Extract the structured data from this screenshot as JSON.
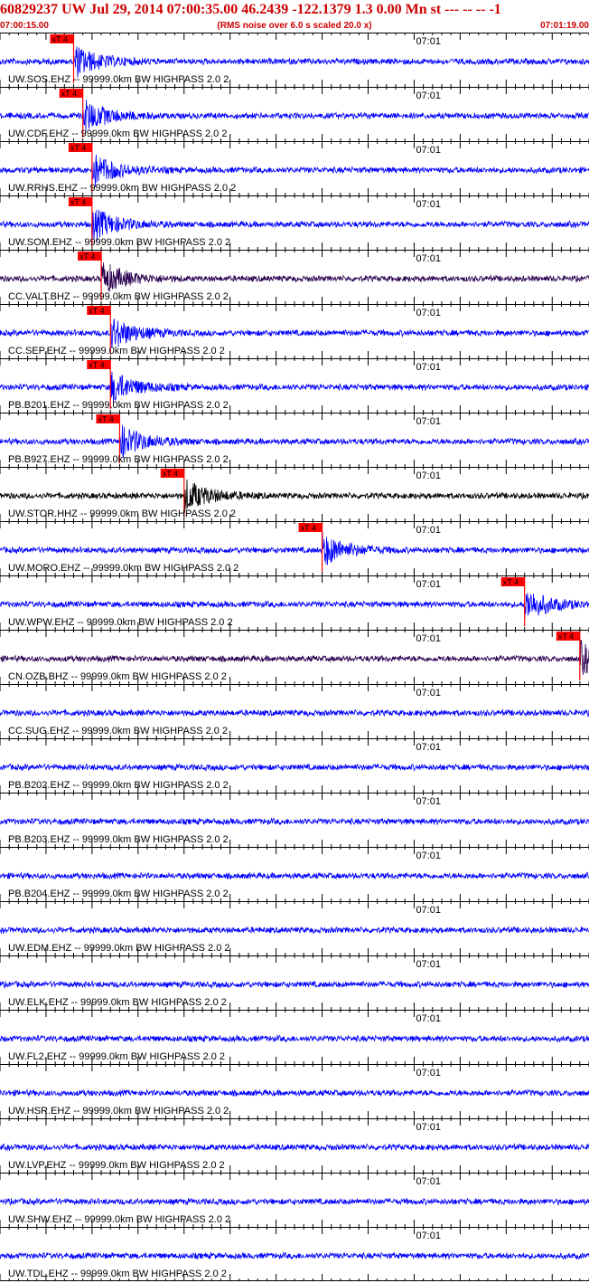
{
  "header": {
    "title": "60829237 UW Jul 29, 2014 07:00:35.00   46.2439 -122.1379  1.3 0.00 Mn st --- -- --  -1",
    "start_time": "07:00:15.00",
    "noise_note": "(RMS noise over 6.0 s scaled 20.0 x)",
    "end_time": "07:01:19.00"
  },
  "colors": {
    "accent": "#cc0000",
    "trace_blue": "#0000ff",
    "trace_purple": "#2a0050",
    "trace_black": "#000000",
    "pick_box": "#ff0000"
  },
  "chart_data": {
    "type": "line",
    "x_start": "07:00:15.00",
    "x_end": "07:01:19.00",
    "minute_tick_label": "07:01",
    "pick_label": "xT 4",
    "traces": [
      {
        "name": "UW.SOS.EHZ -- 99999.0km BW  HIGHPASS  2.0  2",
        "color": "trace_blue",
        "pick_time": "07:00:23"
      },
      {
        "name": "UW.CDF.EHZ -- 99999.0km BW  HIGHPASS  2.0  2",
        "color": "trace_blue",
        "pick_time": "07:00:24"
      },
      {
        "name": "UW.RRHS.EHZ -- 99999.0km BW  HIGHPASS  2.0  2",
        "color": "trace_blue",
        "pick_time": "07:00:25"
      },
      {
        "name": "UW.SOM.EHZ -- 99999.0km BW  HIGHPASS  2.0  2",
        "color": "trace_blue",
        "pick_time": "07:00:25"
      },
      {
        "name": "CC.VALT.BHZ -- 99999.0km BW  HIGHPASS  2.0  2",
        "color": "trace_purple",
        "pick_time": "07:00:26"
      },
      {
        "name": "CC.SEP.EHZ -- 99999.0km BW  HIGHPASS  2.0  2",
        "color": "trace_blue",
        "pick_time": "07:00:27"
      },
      {
        "name": "PB.B201.EHZ -- 99999.0km BW  HIGHPASS  2.0  2",
        "color": "trace_blue",
        "pick_time": "07:00:27"
      },
      {
        "name": "PB.B927.EHZ -- 99999.0km BW  HIGHPASS  2.0  2",
        "color": "trace_blue",
        "pick_time": "07:00:28"
      },
      {
        "name": "UW.STOR.HHZ -- 99999.0km BW  HIGHPASS  2.0  2",
        "color": "trace_black",
        "pick_time": "07:00:35"
      },
      {
        "name": "UW.MORO.EHZ -- 99999.0km BW  HIGHPASS  2.0  2",
        "color": "trace_blue",
        "pick_time": "07:00:50"
      },
      {
        "name": "UW.WPW.EHZ -- 99999.0km BW  HIGHPASS  2.0  2",
        "color": "trace_blue",
        "pick_time": "07:01:12"
      },
      {
        "name": "CN.OZB.BHZ -- 99999.0km BW  HIGHPASS  2.0  2",
        "color": "trace_purple",
        "pick_time": "07:01:18"
      },
      {
        "name": "CC.SUG.EHZ -- 99999.0km BW  HIGHPASS  2.0  2",
        "color": "trace_blue"
      },
      {
        "name": "PB.B202.EHZ -- 99999.0km BW  HIGHPASS  2.0  2",
        "color": "trace_blue"
      },
      {
        "name": "PB.B203.EHZ -- 99999.0km BW  HIGHPASS  2.0  2",
        "color": "trace_blue"
      },
      {
        "name": "PB.B204.EHZ -- 99999.0km BW  HIGHPASS  2.0  2",
        "color": "trace_blue"
      },
      {
        "name": "UW.EDM.EHZ -- 99999.0km BW  HIGHPASS  2.0  2",
        "color": "trace_blue"
      },
      {
        "name": "UW.ELK.EHZ -- 99999.0km BW  HIGHPASS  2.0  2",
        "color": "trace_blue"
      },
      {
        "name": "UW.FL2.EHZ -- 99999.0km BW  HIGHPASS  2.0  2",
        "color": "trace_blue"
      },
      {
        "name": "UW.HSR.EHZ -- 99999.0km BW  HIGHPASS  2.0  2",
        "color": "trace_blue"
      },
      {
        "name": "UW.LVP.EHZ -- 99999.0km BW  HIGHPASS  2.0  2",
        "color": "trace_blue"
      },
      {
        "name": "UW.SHW.EHZ -- 99999.0km BW  HIGHPASS  2.0  2",
        "color": "trace_blue"
      },
      {
        "name": "UW.TDL.EHZ -- 99999.0km BW  HIGHPASS  2.0  2",
        "color": "trace_blue"
      }
    ]
  }
}
